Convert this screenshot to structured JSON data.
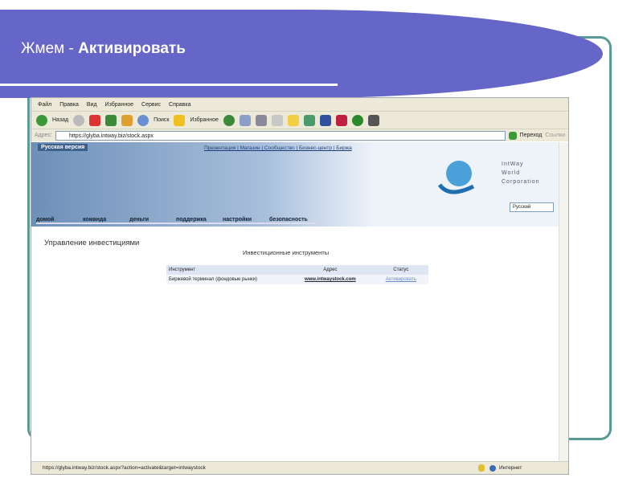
{
  "slide": {
    "title_prefix": "Жмем - ",
    "title_bold": "Активировать"
  },
  "browser": {
    "menu": [
      "Файл",
      "Правка",
      "Вид",
      "Избранное",
      "Сервис",
      "Справка"
    ],
    "toolbar": {
      "back": "Назад",
      "search": "Поиск",
      "favorites": "Избранное"
    },
    "address_label": "Адрес:",
    "address": "https://glyba.intway.biz/stock.aspx",
    "go": "Переход",
    "links": "Ссылки",
    "status_url": "https://glyba.intway.biz/stock.aspx?action=activate&target=intwaystock",
    "zone": "Интернет"
  },
  "site": {
    "english_version": "Русская версия",
    "top_links": "Презентация | Магазин | Сообщество | Бизнес-центр | Биржа",
    "logo": [
      "IntWay",
      "World",
      "Corporation"
    ],
    "language": "Русский",
    "nav": [
      "домой",
      "команда",
      "деньги",
      "поддержка",
      "настройки",
      "безопасность"
    ],
    "page_title": "Управление инвестициями",
    "table_title": "Инвестиционные инструменты",
    "columns": [
      "Инструмент",
      "Адрес",
      "Статус"
    ],
    "row": {
      "instrument": "Биржевой терминал (фондовые рынки)",
      "address": "www.intwaystock.com",
      "status": "Активировать"
    }
  }
}
